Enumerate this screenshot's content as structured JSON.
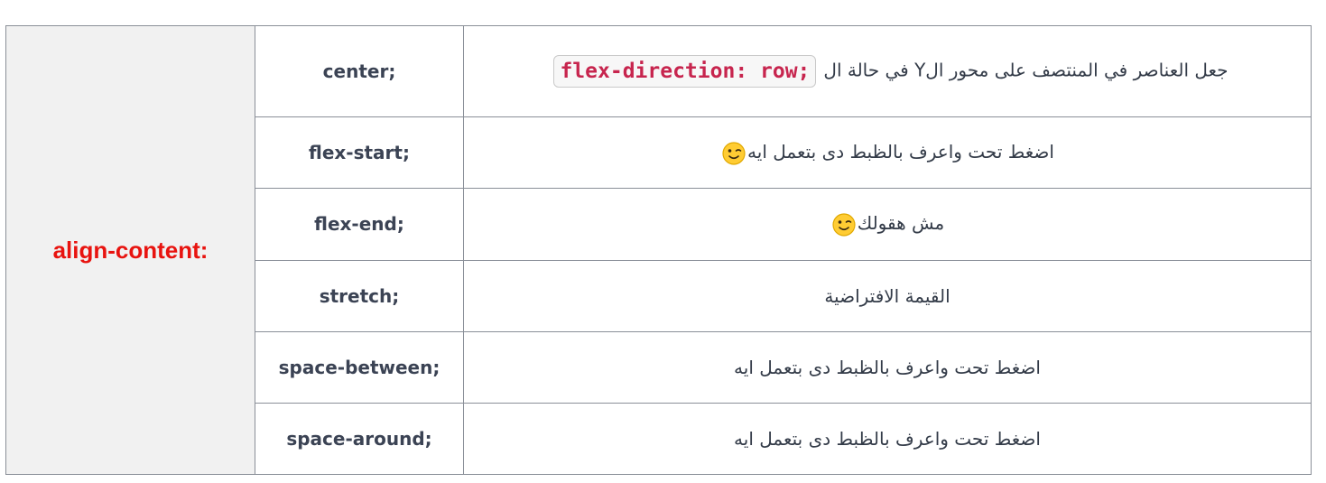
{
  "property": "align-content:",
  "rows": [
    {
      "value": "center;",
      "desc_before": "جعل العناصر في المنتصف على محور الY في حالة ال",
      "code": "flex-direction: row;",
      "emoji": ""
    },
    {
      "value": "flex-start;",
      "desc_before": "اضغط تحت واعرف بالظبط دى بتعمل ايه",
      "code": "",
      "emoji": "winking-face-icon"
    },
    {
      "value": "flex-end;",
      "desc_before": "مش هقولك",
      "code": "",
      "emoji": "winking-face-icon"
    },
    {
      "value": "stretch;",
      "desc_before": "القيمة الافتراضية",
      "code": "",
      "emoji": ""
    },
    {
      "value": "space-between;",
      "desc_before": "اضغط تحت واعرف بالظبط دى بتعمل ايه",
      "code": "",
      "emoji": ""
    },
    {
      "value": "space-around;",
      "desc_before": "اضغط تحت واعرف بالظبط دى بتعمل ايه",
      "code": "",
      "emoji": ""
    }
  ],
  "colors": {
    "property_text": "#e8130f",
    "property_bg": "#f1f1f1",
    "code_text": "#c7254e",
    "border": "#8a8f98"
  }
}
